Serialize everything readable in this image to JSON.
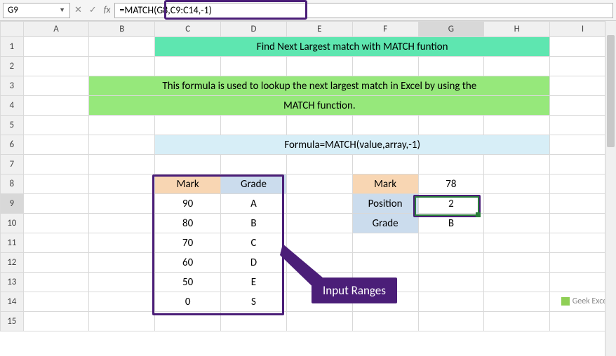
{
  "name_box": "G9",
  "formula_bar": "=MATCH(G8,C9:C14,-1)",
  "columns": [
    "A",
    "B",
    "C",
    "D",
    "E",
    "F",
    "G",
    "H",
    "I"
  ],
  "row_count": 15,
  "title": "Find Next Largest match with MATCH funtion",
  "description_line1": "This formula is used to lookup the next largest match in Excel by using the",
  "description_line2": "MATCH function.",
  "formula_text": "Formula=MATCH(value,array,-1)",
  "input_table": {
    "headers": [
      "Mark",
      "Grade"
    ],
    "rows": [
      [
        "90",
        "A"
      ],
      [
        "80",
        "B"
      ],
      [
        "70",
        "C"
      ],
      [
        "60",
        "D"
      ],
      [
        "50",
        "E"
      ],
      [
        "0",
        "S"
      ]
    ]
  },
  "lookup": {
    "labels": [
      "Mark",
      "Position",
      "Grade"
    ],
    "values": [
      "78",
      "2",
      "B"
    ]
  },
  "callout_label": "Input Ranges",
  "watermark": "Geek Excel",
  "selected_cell": "G9",
  "selected_col": "G",
  "selected_row": 9
}
